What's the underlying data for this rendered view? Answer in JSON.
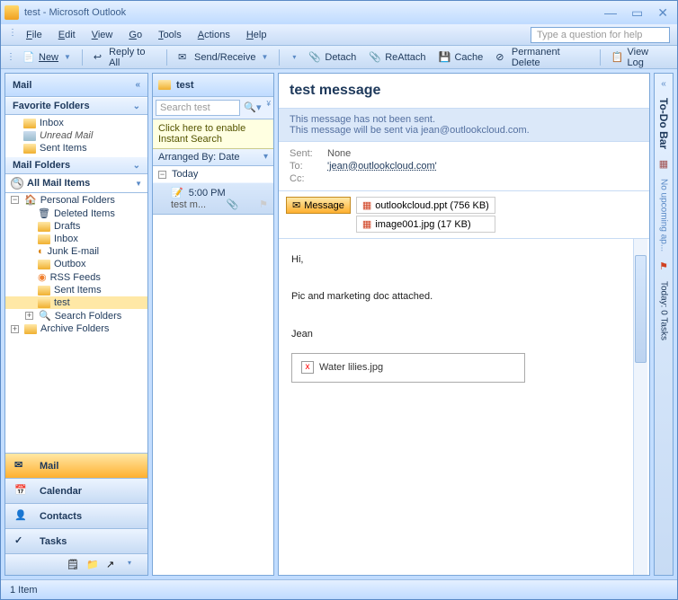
{
  "title": "test - Microsoft Outlook",
  "menu": {
    "file": "File",
    "edit": "Edit",
    "view": "View",
    "go": "Go",
    "tools": "Tools",
    "actions": "Actions",
    "help": "Help"
  },
  "helpbox": "Type a question for help",
  "toolbar": {
    "new": "New",
    "replyall": "Reply to All",
    "sendreceive": "Send/Receive",
    "detach": "Detach",
    "reattach": "ReAttach",
    "cache": "Cache",
    "permdelete": "Permanent Delete",
    "viewlog": "View Log"
  },
  "nav": {
    "header": "Mail",
    "favfolders": "Favorite Folders",
    "favitems": [
      "Inbox",
      "Unread Mail",
      "Sent Items"
    ],
    "mailfolders": "Mail Folders",
    "allmail": "All Mail Items",
    "tree": {
      "personal": "Personal Folders",
      "items": [
        "Deleted Items",
        "Drafts",
        "Inbox",
        "Junk E-mail",
        "Outbox",
        "RSS Feeds",
        "Sent Items",
        "test",
        "Search Folders"
      ],
      "archive": "Archive Folders"
    },
    "btns": {
      "mail": "Mail",
      "calendar": "Calendar",
      "contacts": "Contacts",
      "tasks": "Tasks"
    }
  },
  "list": {
    "header": "test",
    "searchplaceholder": "Search test",
    "instant": "Click here to enable Instant Search",
    "arrange": "Arranged By: Date",
    "today": "Today",
    "msg": {
      "time": "5:00 PM",
      "subj": "test m..."
    }
  },
  "reading": {
    "subject": "test message",
    "info1": "This message has not been sent.",
    "info2": "This message will be sent via jean@outlookcloud.com.",
    "sent_lbl": "Sent:",
    "sent_val": "None",
    "to_lbl": "To:",
    "to_val": "'jean@outlookcloud.com'",
    "cc_lbl": "Cc:",
    "msgbadge": "Message",
    "att1": "outlookcloud.ppt (756 KB)",
    "att2": "image001.jpg (17 KB)",
    "body1": "Hi,",
    "body2": "Pic and marketing doc attached.",
    "body3": "Jean",
    "imgname": "Water lilies.jpg"
  },
  "todo": {
    "title": "To-Do Bar",
    "noappt": "No upcoming ap...",
    "todaytasks": "Today: 0 Tasks"
  },
  "status": "1 Item"
}
